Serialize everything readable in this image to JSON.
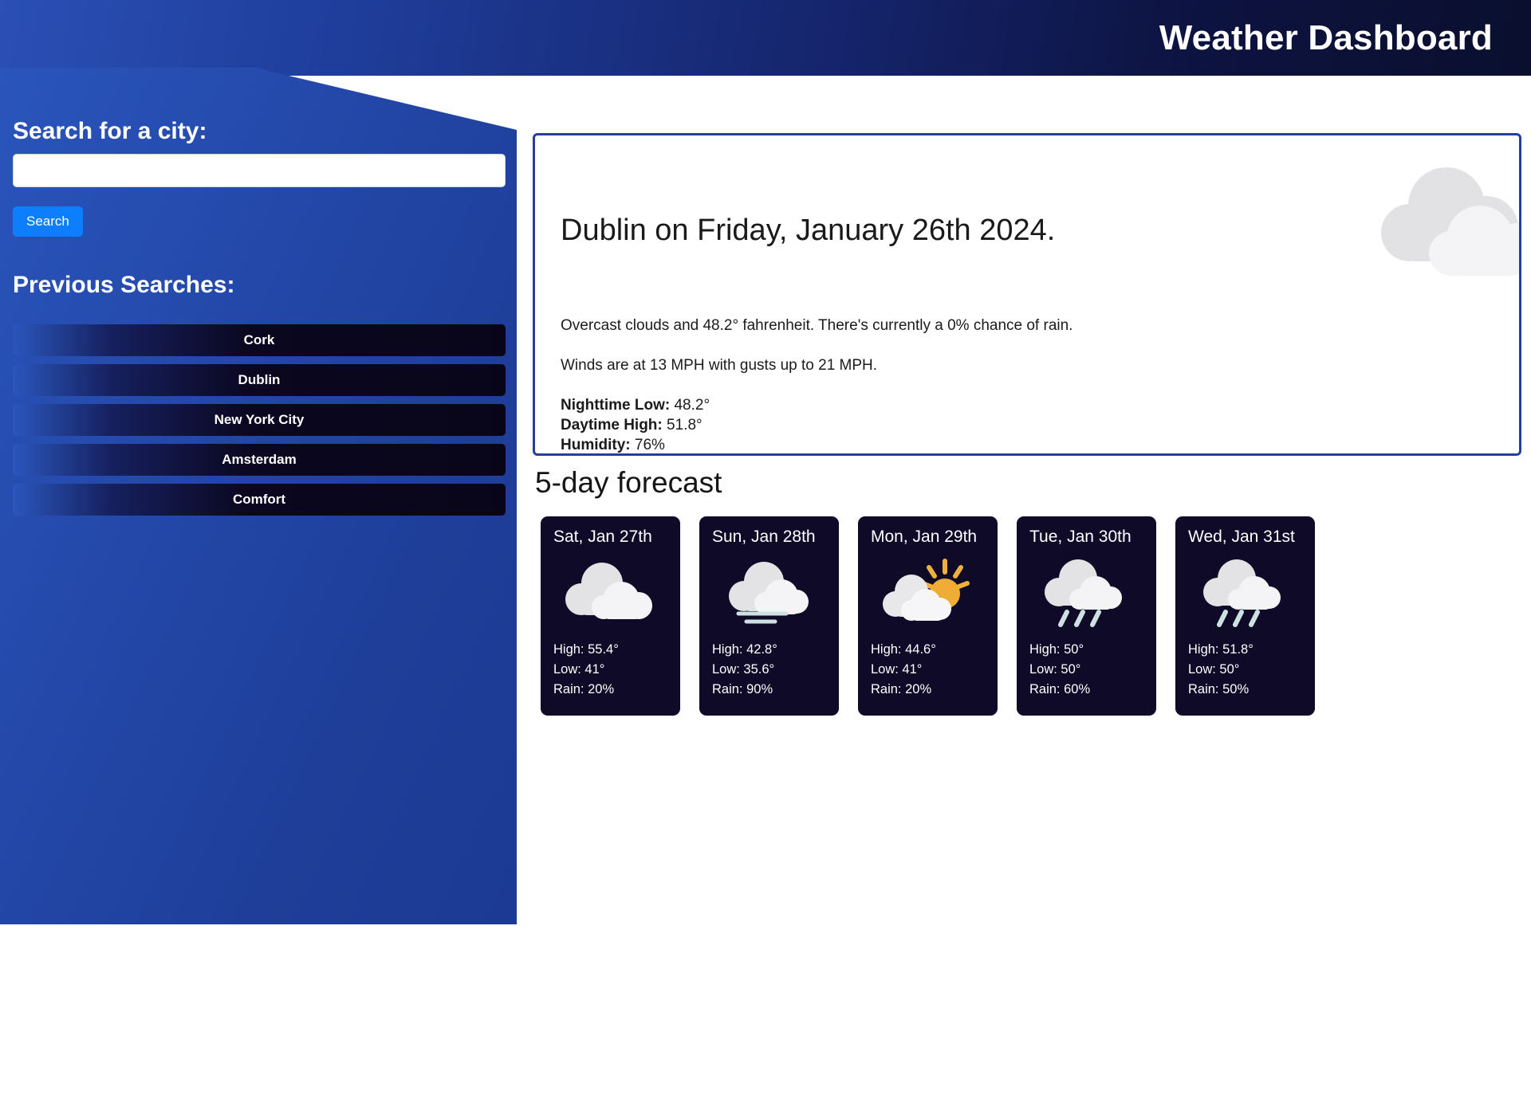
{
  "header": {
    "title": "Weather Dashboard"
  },
  "sidebar": {
    "search_heading": "Search for a city:",
    "search_value": "",
    "search_placeholder": "",
    "search_button": "Search",
    "previous_heading": "Previous Searches:",
    "history": [
      {
        "label": "Cork"
      },
      {
        "label": "Dublin"
      },
      {
        "label": "New York City"
      },
      {
        "label": "Amsterdam"
      },
      {
        "label": "Comfort"
      }
    ]
  },
  "current": {
    "title": "Dublin on Friday, January 26th 2024.",
    "conditions": "Overcast clouds and 48.2° fahrenheit. There's currently a 0% chance of rain.",
    "wind": "Winds are at 13 MPH with gusts up to 21 MPH.",
    "night_low_label": "Nighttime Low:",
    "night_low_value": "48.2°",
    "day_high_label": "Daytime High:",
    "day_high_value": "51.8°",
    "humidity_label": "Humidity:",
    "humidity_value": "76%",
    "icon": "overcast-clouds-icon"
  },
  "forecast": {
    "title": "5-day forecast",
    "days": [
      {
        "day": "Sat, Jan 27th",
        "icon": "cloud-icon",
        "high": "High: 55.4°",
        "low": "Low: 41°",
        "rain": "Rain: 20%"
      },
      {
        "day": "Sun, Jan 28th",
        "icon": "windy-cloud-icon",
        "high": "High: 42.8°",
        "low": "Low: 35.6°",
        "rain": "Rain: 90%"
      },
      {
        "day": "Mon, Jan 29th",
        "icon": "sun-behind-cloud-icon",
        "high": "High: 44.6°",
        "low": "Low: 41°",
        "rain": "Rain: 20%"
      },
      {
        "day": "Tue, Jan 30th",
        "icon": "rain-cloud-icon",
        "high": "High: 50°",
        "low": "Low: 50°",
        "rain": "Rain: 60%"
      },
      {
        "day": "Wed, Jan 31st",
        "icon": "rain-cloud-icon",
        "high": "High: 51.8°",
        "low": "Low: 50°",
        "rain": "Rain: 50%"
      }
    ]
  },
  "colors": {
    "header_gradient_start": "#2a4fb5",
    "header_gradient_end": "#0a0f2e",
    "sidebar_blue": "#2449ab",
    "accent_button": "#0d7efd",
    "card_border": "#23409b",
    "forecast_card_bg": "#100a29",
    "cloud_light": "#f3f3f5",
    "cloud_dark": "#e0e0e3",
    "sun_orange": "#e8a33d",
    "rain_blue": "#cfe3e6"
  }
}
